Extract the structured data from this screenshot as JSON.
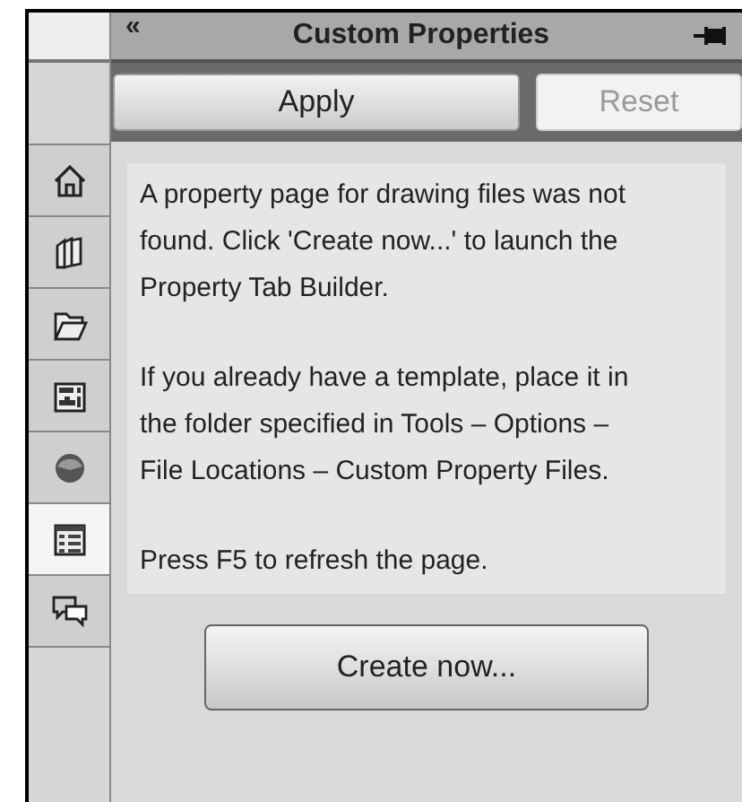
{
  "panel": {
    "collapse": "«",
    "title": "Custom Properties"
  },
  "sidebar": {
    "tabs": [
      {
        "kind": "home",
        "selected": false
      },
      {
        "kind": "library",
        "selected": false
      },
      {
        "kind": "folder",
        "selected": false
      },
      {
        "kind": "layout",
        "selected": false
      },
      {
        "kind": "sphere",
        "selected": false
      },
      {
        "kind": "properties",
        "selected": true
      },
      {
        "kind": "chat",
        "selected": false
      }
    ]
  },
  "buttons": [
    {
      "label": "Apply",
      "disabled": false
    },
    {
      "label": "Reset",
      "disabled": true
    }
  ],
  "message": [
    "A property page for drawing files was not found. Click 'Create now...' to launch the Property Tab Builder.",
    "If you already have a template, place it in the folder specified in Tools – Options – File Locations – Custom Property Files.",
    "Press F5 to refresh the page."
  ],
  "action": {
    "label": "Create now..."
  }
}
